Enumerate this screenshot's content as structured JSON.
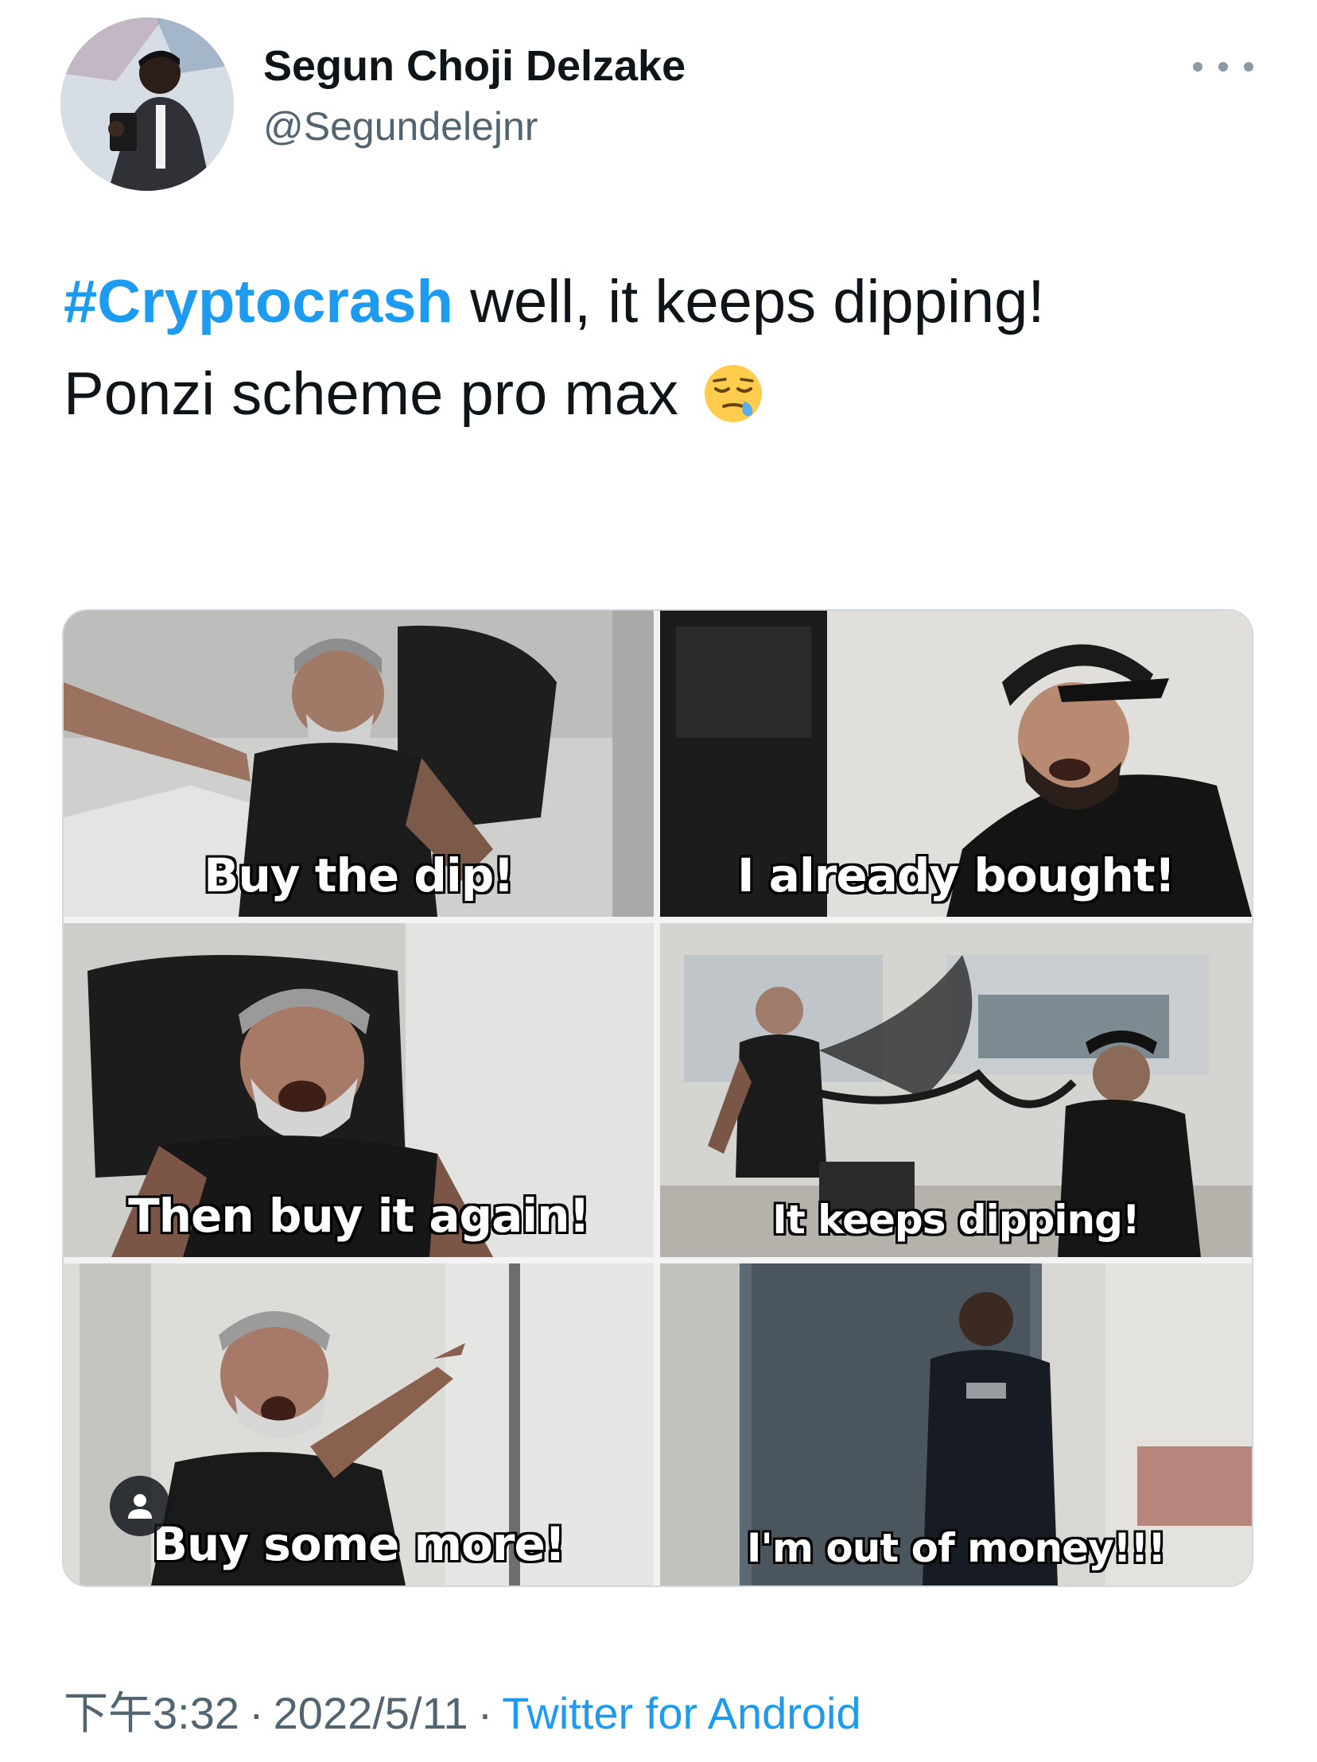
{
  "tweet": {
    "author": {
      "display_name": "Segun Choji Delzake",
      "handle": "@Segundelejnr"
    },
    "text": {
      "hashtag": "#Cryptocrash",
      "line1_rest": " well, it keeps dipping!",
      "line2": "Ponzi scheme pro max",
      "emoji": "sleepy-face-emoji"
    },
    "media": {
      "panels": [
        {
          "caption": "Buy the dip!"
        },
        {
          "caption": "I already bought!"
        },
        {
          "caption": "Then buy it again!"
        },
        {
          "caption": "It keeps dipping!"
        },
        {
          "caption": "Buy some more!"
        },
        {
          "caption": "I'm out of money!!!"
        }
      ]
    },
    "meta": {
      "time": "下午3:32",
      "date": "2022/5/11",
      "separator": "·",
      "source": "Twitter for Android"
    }
  },
  "colors": {
    "accent": "#1d9bf0",
    "text": "#0f1419",
    "secondary": "#536471"
  }
}
